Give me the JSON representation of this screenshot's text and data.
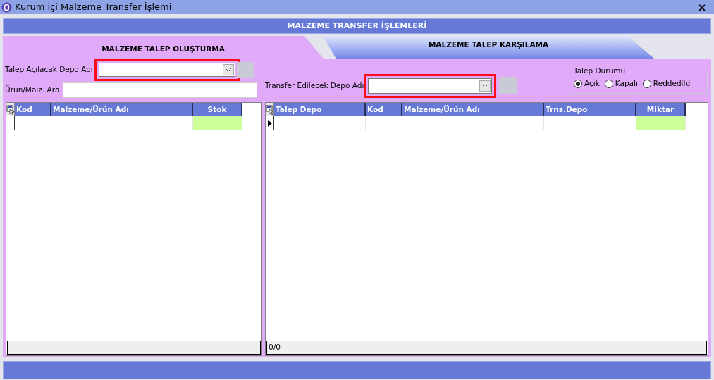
{
  "window": {
    "title": "Kurum içi Malzeme Transfer İşlemi",
    "close": "×"
  },
  "header": "MALZEME TRANSFER İŞLEMLERİ",
  "tabs": [
    {
      "label": "MALZEME TALEP OLUŞTURMA",
      "selected": true
    },
    {
      "label": "MALZEME TALEP KARŞILAMA",
      "selected": false
    }
  ],
  "left": {
    "depo_label": "Talep Açılacak Depo Adı",
    "depo_highlighted": true,
    "search_label": "Ürün/Malz. Ara",
    "columns": [
      {
        "label": "Kod"
      },
      {
        "label": "Malzeme/Ürün Adı"
      },
      {
        "label": "Stok"
      }
    ]
  },
  "right": {
    "depo_label": "Transfer Edilecek Depo Adı",
    "depo_highlighted": true,
    "status_group": {
      "title": "Talep Durumu",
      "options": [
        {
          "label": "Açık",
          "selected": true
        },
        {
          "label": "Kapalı",
          "selected": false
        },
        {
          "label": "Reddedildi",
          "selected": false
        }
      ]
    },
    "columns": [
      {
        "label": "Talep Depo"
      },
      {
        "label": "Kod"
      },
      {
        "label": "Malzeme/Ürün Adı"
      },
      {
        "label": "Trns.Depo"
      },
      {
        "label": "Miktar"
      }
    ],
    "footer": "0/0"
  }
}
